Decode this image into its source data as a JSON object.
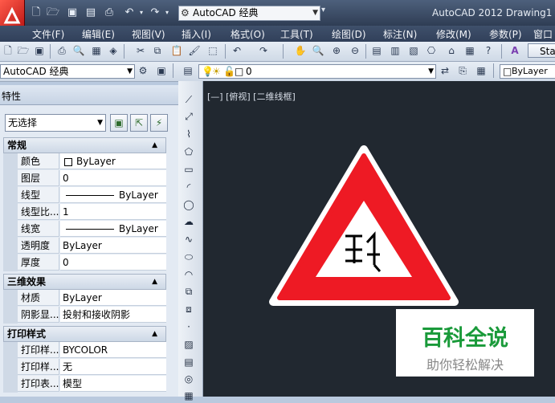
{
  "app": {
    "title": "AutoCAD 2012   Drawing1",
    "workspace": "AutoCAD 经典"
  },
  "menubar": [
    "文件(F)",
    "编辑(E)",
    "视图(V)",
    "插入(I)",
    "格式(O)",
    "工具(T)",
    "绘图(D)",
    "标注(N)",
    "修改(M)",
    "参数(P)",
    "窗口"
  ],
  "toolbar2": {
    "workspace_combo": "AutoCAD 经典",
    "layer_combo": "0",
    "color_combo": "ByLayer",
    "style_button": "Sta"
  },
  "properties": {
    "title": "特性",
    "selection": "无选择",
    "sections": [
      {
        "title": "常规",
        "rows": [
          {
            "key": "颜色",
            "value": "ByLayer"
          },
          {
            "key": "图层",
            "value": "0"
          },
          {
            "key": "线型",
            "value": "ByLayer"
          },
          {
            "key": "线型比...",
            "value": "1"
          },
          {
            "key": "线宽",
            "value": "ByLayer"
          },
          {
            "key": "透明度",
            "value": "ByLayer"
          },
          {
            "key": "厚度",
            "value": "0"
          }
        ]
      },
      {
        "title": "三维效果",
        "rows": [
          {
            "key": "材质",
            "value": "ByLayer"
          },
          {
            "key": "阴影显...",
            "value": "投射和接收阴影"
          }
        ]
      },
      {
        "title": "打印样式",
        "rows": [
          {
            "key": "打印样...",
            "value": "BYCOLOR"
          },
          {
            "key": "打印样...",
            "value": "无"
          },
          {
            "key": "打印表...",
            "value": "模型"
          }
        ]
      }
    ]
  },
  "viewport": {
    "label": "[—] [俯视] [二维线框]"
  },
  "watermark": {
    "main": "百科全说",
    "sub": "助你轻松解决"
  },
  "colors": {
    "canvas": "#212830",
    "sign_red": "#ee1a24",
    "watermark_green": "#1a9a3a"
  }
}
